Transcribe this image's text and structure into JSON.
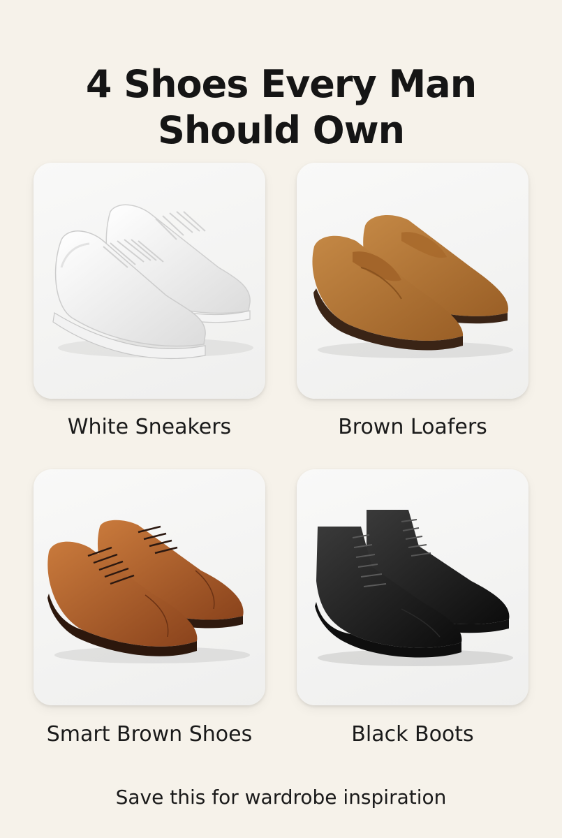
{
  "title": {
    "line1": "4 Shoes Every Man",
    "line2": "Should Own"
  },
  "items": [
    {
      "label": "White Sneakers",
      "icon": "white-sneakers-image"
    },
    {
      "label": "Brown Loafers",
      "icon": "brown-loafers-image"
    },
    {
      "label": "Smart Brown Shoes",
      "icon": "smart-brown-shoes-image"
    },
    {
      "label": "Black Boots",
      "icon": "black-boots-image"
    }
  ],
  "footer": "Save this for wardrobe inspiration",
  "colors": {
    "background": "#f6f2ea",
    "card": "#f4f4f3",
    "text": "#1a1a1a"
  }
}
